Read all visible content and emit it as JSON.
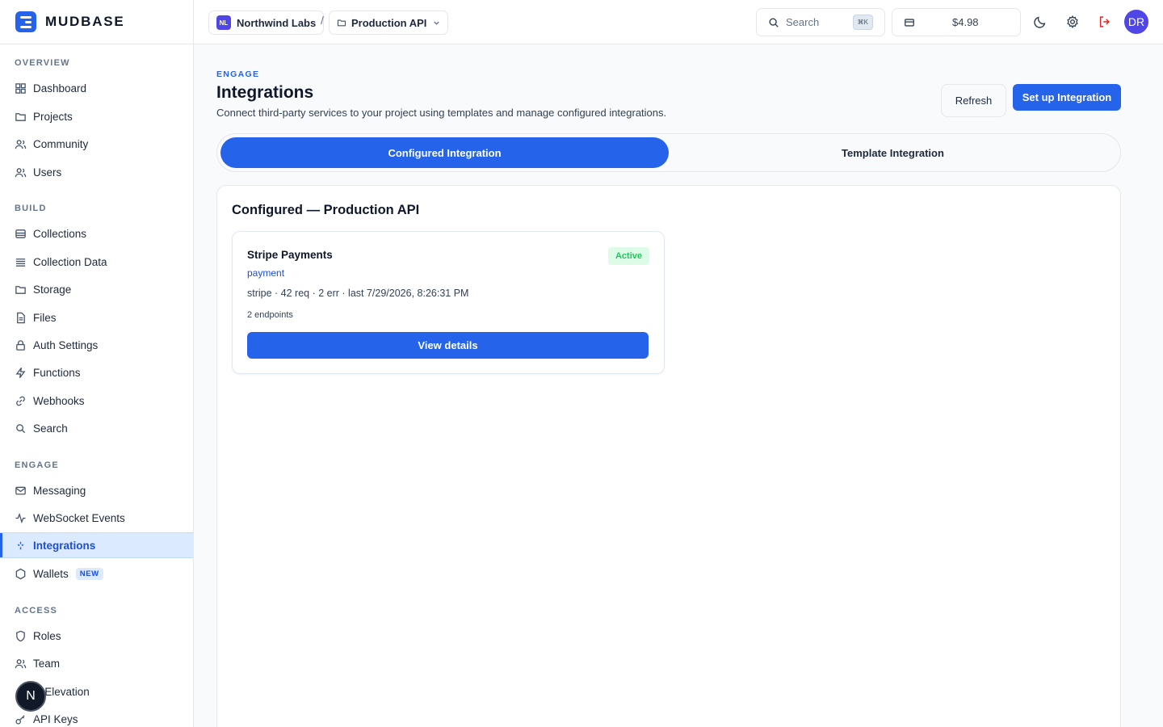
{
  "brand": {
    "name": "MUDBASE"
  },
  "sidebar": {
    "sections": {
      "overview": "OVERVIEW",
      "build": "BUILD",
      "engage": "ENGAGE",
      "access": "ACCESS"
    },
    "items": {
      "dashboard": "Dashboard",
      "projects": "Projects",
      "community": "Community",
      "users": "Users",
      "collections": "Collections",
      "collection_data": "Collection Data",
      "storage": "Storage",
      "files": "Files",
      "auth_settings": "Auth Settings",
      "functions": "Functions",
      "webhooks": "Webhooks",
      "search": "Search",
      "messaging": "Messaging",
      "websocket_events": "WebSocket Events",
      "integrations": "Integrations",
      "wallets": "Wallets",
      "roles": "Roles",
      "team": "Team",
      "role_elevation": "le Elevation",
      "api_keys": "API Keys"
    },
    "wallets_badge": "NEW",
    "active_item": "Integrations",
    "fab_label": "N"
  },
  "topbar": {
    "org_initials": "NL",
    "org_name": "Northwind Labs",
    "separator": "/",
    "project_name": "Production API",
    "search_label": "Search",
    "search_shortcut": "⌘K",
    "wallet_amount": "$4.98",
    "user_initials": "DR"
  },
  "page": {
    "eyebrow": "ENGAGE",
    "title": "Integrations",
    "subtitle": "Connect third-party services to your project using templates and manage configured integrations.",
    "refresh_label": "Refresh",
    "setup_label": "Set up Integration"
  },
  "tabs": {
    "configured": "Configured Integration",
    "template": "Template Integration",
    "active": "configured"
  },
  "panel": {
    "title": "Configured — Production API",
    "integrations": [
      {
        "name": "Stripe Payments",
        "status": "Active",
        "category": "payment",
        "meta": "stripe · 42 req · 2 err · last 7/29/2026, 8:26:31 PM",
        "endpoints": "2 endpoints",
        "action_label": "View details"
      }
    ]
  },
  "colors": {
    "accent": "#2563eb",
    "active_nav_bg": "#dbeafe",
    "status_active": "#22c55e",
    "logout": "#dc2626"
  },
  "icons": {
    "dashboard": "grid-icon",
    "projects": "folder-icon",
    "community": "users-icon",
    "wallets": "hexagon-icon",
    "theme": "moon-icon",
    "settings": "gear-icon",
    "logout": "logout-icon"
  }
}
